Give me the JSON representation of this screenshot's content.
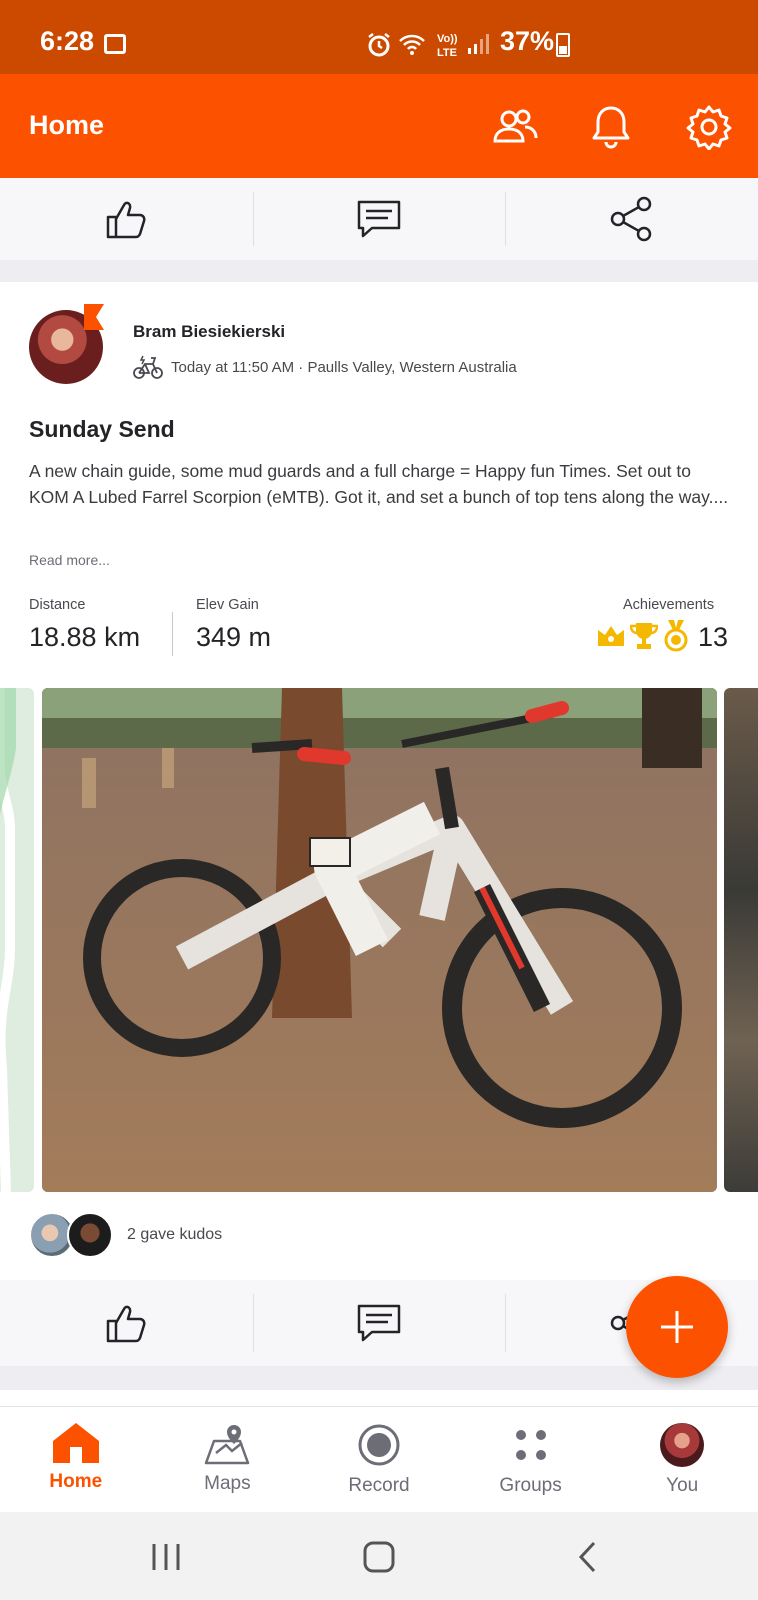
{
  "status_bar": {
    "time": "6:28",
    "battery": "37%"
  },
  "app_bar": {
    "title": "Home"
  },
  "post": {
    "athlete_name": "Bram Biesiekierski",
    "meta": "Today at 11:50 AM · Paulls Valley, Western Australia",
    "title": "Sunday Send",
    "description": "A new chain guide, some mud guards and a full charge = Happy fun Times.  Set out to KOM A Lubed Farrel Scorpion (eMTB).  Got it, and set a bunch of top tens along the way....",
    "read_more": "Read more...",
    "stats": {
      "distance_label": "Distance",
      "distance_value": "18.88 km",
      "elev_label": "Elev Gain",
      "elev_value": "349 m",
      "achievements_label": "Achievements",
      "achievements_value": "13"
    },
    "kudos_text": "2 gave kudos"
  },
  "bottom_nav": {
    "items": [
      {
        "label": "Home",
        "icon": "home-icon"
      },
      {
        "label": "Maps",
        "icon": "maps-icon"
      },
      {
        "label": "Record",
        "icon": "record-icon"
      },
      {
        "label": "Groups",
        "icon": "groups-icon"
      },
      {
        "label": "You",
        "icon": "profile-avatar"
      }
    ]
  },
  "colors": {
    "brand": "#fc5200",
    "status_bar": "#cc4a00",
    "achievement_gold": "#f5b800"
  }
}
